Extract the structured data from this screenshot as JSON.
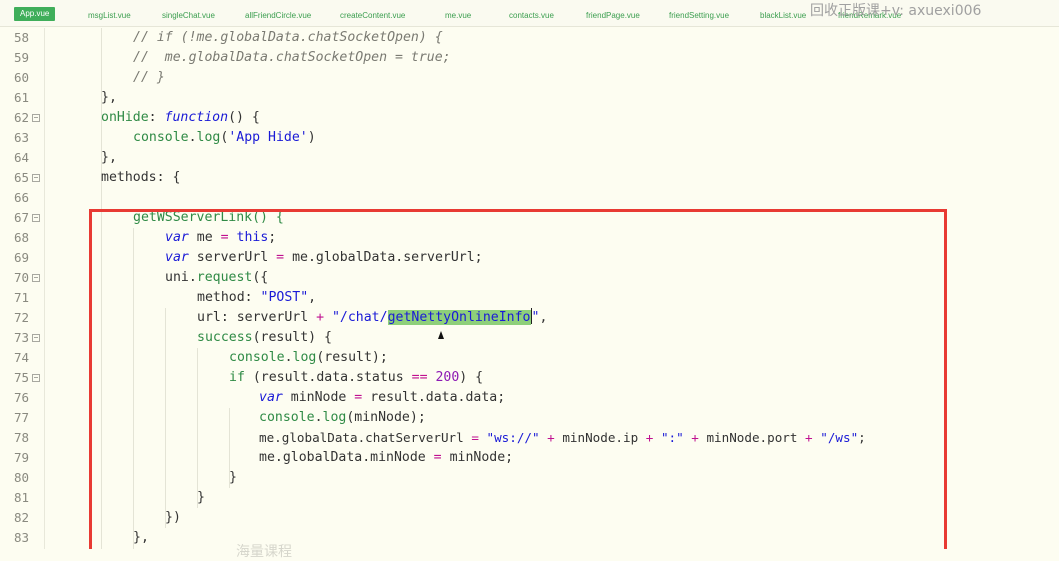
{
  "tabs": [
    {
      "label": "App.vue",
      "active": true
    },
    {
      "label": "msgList.vue"
    },
    {
      "label": "singleChat.vue"
    },
    {
      "label": "allFriendCircle.vue"
    },
    {
      "label": "createContent.vue"
    },
    {
      "label": "me.vue"
    },
    {
      "label": "contacts.vue"
    },
    {
      "label": "friendPage.vue"
    },
    {
      "label": "friendSetting.vue"
    },
    {
      "label": "blackList.vue"
    },
    {
      "label": "friendRemark.vue"
    }
  ],
  "watermark": "回收正版课+v: axuexi006",
  "line_numbers": [
    "58",
    "59",
    "60",
    "61",
    "62",
    "63",
    "64",
    "65",
    "66",
    "67",
    "68",
    "69",
    "70",
    "71",
    "72",
    "73",
    "74",
    "75",
    "76",
    "77",
    "78",
    "79",
    "80",
    "81",
    "82",
    "83"
  ],
  "code": {
    "l58": "// if (!me.globalData.chatSocketOpen) {",
    "l59": "//  me.globalData.chatSocketOpen = true;",
    "l60": "// }",
    "l61": "},",
    "l62_a": "onHide",
    "l62_b": ": ",
    "l62_c": "function",
    "l62_d": "() {",
    "l63_a": "console",
    "l63_b": ".",
    "l63_c": "log",
    "l63_d": "(",
    "l63_e": "'App Hide'",
    "l63_f": ")",
    "l64": "},",
    "l65": "methods: {",
    "l67": "getWSServerLink() {",
    "l68_a": "var",
    "l68_b": " me ",
    "l68_c": "=",
    "l68_d": " ",
    "l68_e": "this",
    "l68_f": ";",
    "l69_a": "var",
    "l69_b": " serverUrl ",
    "l69_c": "=",
    "l69_d": " me.globalData.serverUrl;",
    "l70_a": "uni.",
    "l70_b": "request",
    "l70_c": "({",
    "l71_a": "method: ",
    "l71_b": "\"POST\"",
    "l71_c": ",",
    "l72_a": "url: serverUrl ",
    "l72_b": "+",
    "l72_c": " \"/chat/",
    "l72_d": "getNettyOnlineInfo",
    "l72_e": "\"",
    "l72_f": ",",
    "l73_a": "success",
    "l73_b": "(result) {",
    "l74_a": "console",
    "l74_b": ".",
    "l74_c": "log",
    "l74_d": "(result);",
    "l75_a": "if",
    "l75_b": " (result.data.status ",
    "l75_c": "==",
    "l75_d": " ",
    "l75_e": "200",
    "l75_f": ") {",
    "l76_a": "var",
    "l76_b": " minNode ",
    "l76_c": "=",
    "l76_d": " result.data.data;",
    "l77_a": "console",
    "l77_b": ".",
    "l77_c": "log",
    "l77_d": "(minNode);",
    "l78_a": "me.globalData.chatServerUrl ",
    "l78_b": "=",
    "l78_c": " ",
    "l78_d": "\"ws://\"",
    "l78_e": " ",
    "l78_f": "+",
    "l78_g": " minNode.ip ",
    "l78_h": "+",
    "l78_i": " ",
    "l78_j": "\":\"",
    "l78_k": " ",
    "l78_l": "+",
    "l78_m": " minNode.port ",
    "l78_n": "+",
    "l78_o": " ",
    "l78_p": "\"/ws\"",
    "l78_q": ";",
    "l79_a": "me.globalData.minNode ",
    "l79_b": "=",
    "l79_c": " minNode;",
    "l80": "}",
    "l81": "}",
    "l82": "})",
    "l83": "},"
  },
  "ghost_text": "海量课程"
}
